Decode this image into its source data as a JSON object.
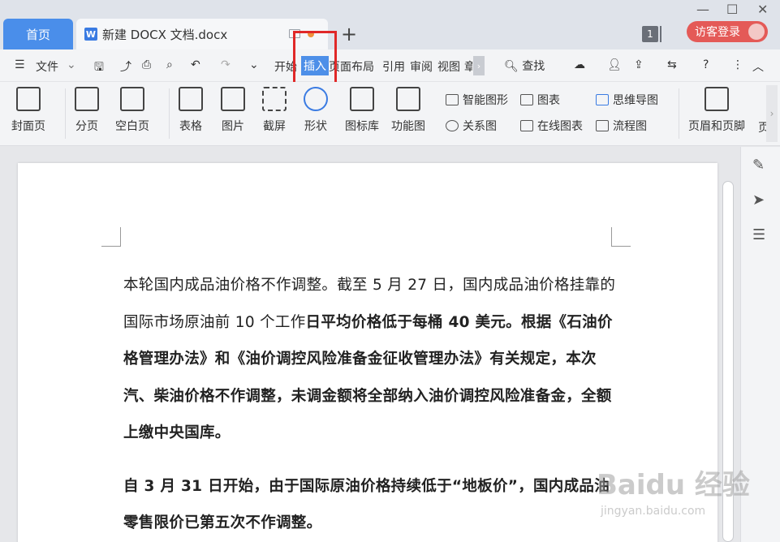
{
  "tabs": {
    "home": "首页",
    "document": "新建 DOCX 文档.docx",
    "doc_icon_letter": "W",
    "add": "+"
  },
  "window": {
    "page_badge": "1",
    "login": "访客登录",
    "minimize": "—",
    "maximize": "☐",
    "close": "✕"
  },
  "menu": {
    "file": "文件",
    "items": [
      "开始",
      "插入",
      "页面布局",
      "引用",
      "审阅",
      "视图",
      "章"
    ],
    "active": "插入",
    "find": "查找"
  },
  "ribbon": {
    "cover": "封面页",
    "page_break": "分页",
    "blank_page": "空白页",
    "table": "表格",
    "picture": "图片",
    "screenshot": "截屏",
    "shape": "形状",
    "icon_lib": "图标库",
    "function_chart": "功能图",
    "smart_art": "智能图形",
    "chart": "图表",
    "mind_map": "思维导图",
    "relation_chart": "关系图",
    "online_chart": "在线图表",
    "flowchart": "流程图",
    "header_footer": "页眉和页脚",
    "page_num_partial": "页"
  },
  "document": {
    "para1_normal": "本轮国内成品油价格不作调整。截至 5 月 27 日，国内成品油价格挂靠的国际市场原油前 10 个工作",
    "para1_bold": "日平均价格低于每桶 40 美元。根据《石油价格管理办法》和《油价调控风险准备金征收管理办法》有关规定，本次汽、柴油价格不作调整，未调金额将全部纳入油价调控风险准备金，全额上缴中央国库。",
    "para2_bold": "自 3 月 31 日开始，由于国际原油价格持续低于“地板价”，国内成品油零售限价已第五次不作调整。"
  },
  "watermark": {
    "logo": "Baidu 经验",
    "url": "jingyan.baidu.com"
  },
  "colors": {
    "accent": "#4a8eea",
    "highlight_box": "#e02828",
    "login": "#e45a57"
  }
}
